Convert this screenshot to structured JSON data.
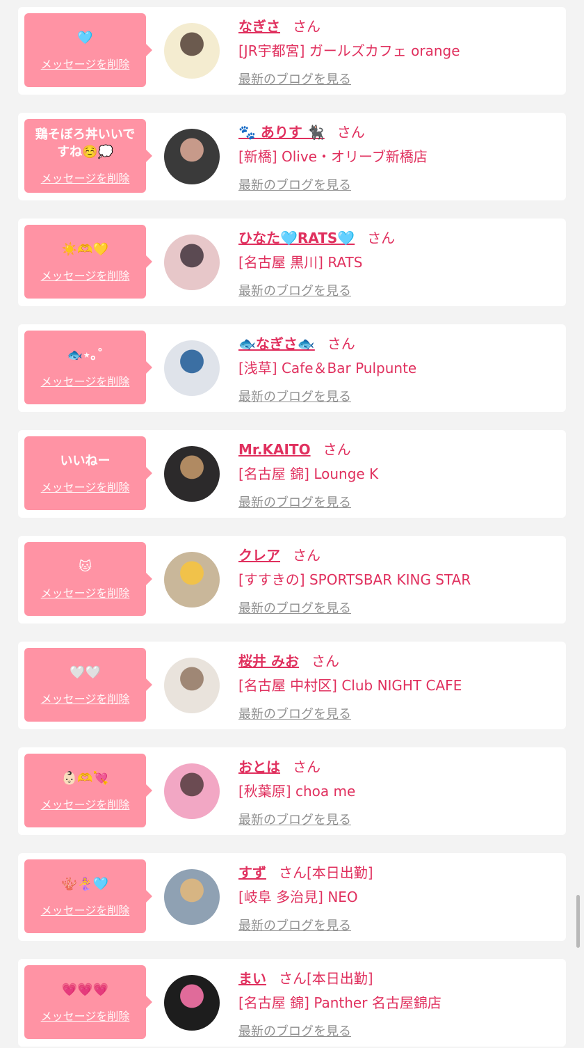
{
  "delete_label": "メッセージを削除",
  "blog_label": "最新のブログを見る",
  "san_label": "さん",
  "items": [
    {
      "message": "🩵",
      "name": "なぎさ",
      "status": "",
      "shop": "[JR宇都宮] ガールズカフェ orange",
      "avatar_colors": [
        "#f4ecd0",
        "#6b5a4e"
      ]
    },
    {
      "message": "鶏そぼろ丼いいですね☺️💭",
      "name": "🐾 ありす 🐈‍⬛",
      "status": "",
      "shop": "[新橋] Olive・オリーブ新橋店",
      "avatar_colors": [
        "#3a3a3a",
        "#c79a8a"
      ]
    },
    {
      "message": "☀️🫶💛",
      "name": "ひなた🩵RATS🩵",
      "status": "",
      "shop": "[名古屋 黒川] RATS",
      "avatar_colors": [
        "#e7c7c9",
        "#5b4a52"
      ]
    },
    {
      "message": "🐟⋆｡˚",
      "name": "🐟なぎさ🐟",
      "status": "",
      "shop": "[浅草] Cafe＆Bar Pulpunte",
      "avatar_colors": [
        "#dfe3ea",
        "#3b6fa3"
      ]
    },
    {
      "message": "いいねー",
      "name": "Mr.KAITO",
      "status": "",
      "shop": "[名古屋 錦] Lounge K",
      "avatar_colors": [
        "#2c2a2b",
        "#b08a62"
      ]
    },
    {
      "message": "🐱",
      "name": "クレア",
      "status": "",
      "shop": "[すすきの] SPORTSBAR KING STAR",
      "avatar_colors": [
        "#c9b79a",
        "#f1c24a"
      ]
    },
    {
      "message": "🤍🤍",
      "name": "桜井 みお",
      "status": "",
      "shop": "[名古屋 中村区] Club NIGHT CAFE",
      "avatar_colors": [
        "#e9e3dc",
        "#9f8775"
      ]
    },
    {
      "message": "👶🏻🫶💘",
      "name": "おとは",
      "status": "",
      "shop": "[秋葉原] choa me",
      "avatar_colors": [
        "#f2a7c4",
        "#6b4b52"
      ]
    },
    {
      "message": "🪸🧜‍♀️🩵",
      "name": "すず",
      "status": "[本日出勤]",
      "shop": "[岐阜 多治見] NEO",
      "avatar_colors": [
        "#8fa1b3",
        "#d7b583"
      ]
    },
    {
      "message": "💗💗💗",
      "name": "まい",
      "status": "[本日出勤]",
      "shop": "[名古屋 錦] Panther 名古屋錦店",
      "avatar_colors": [
        "#1d1d1d",
        "#e06b9a"
      ]
    }
  ]
}
